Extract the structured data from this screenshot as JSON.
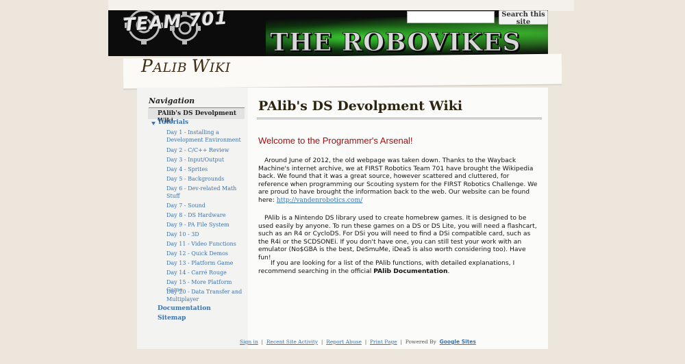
{
  "header": {
    "team_text": "TEAM 701",
    "title_text": "THE ROBOVIKES",
    "search_placeholder": "",
    "search_button": "Search this site"
  },
  "site_title": {
    "first": "P",
    "rest": "ALIB ",
    "w": "W",
    "iki": "IKI"
  },
  "nav": {
    "heading": "Navigation",
    "current": "PAlib's DS Devolpment Wiki",
    "tutorials": "Tutorials",
    "days": [
      "Day 1 - Installing a Development Environment",
      "Day 2 - C/C++ Review",
      "Day 3 - Input/Output",
      "Day 4 - Sprites",
      "Day 5 - Backgrounds",
      "Day 6 - Dev-related Math Stuff",
      "Day 7 - Sound",
      "Day 8 - DS Hardware",
      "Day 9 - PA File System",
      "Day 10 - 3D",
      "Day 11 - Video Functions",
      "Day 12 - Quick Demos",
      "Day 13 - Platform Game",
      "Day 14 - Carré Rouge",
      "Day 15 - More Platform Game",
      "Day 20 - Data Transfer and Multiplayer"
    ],
    "documentation": "Documentation",
    "sitemap": "Sitemap"
  },
  "main": {
    "title": "PAlib's DS Devolpment Wiki",
    "welcome": "Welcome to the Programmer's Arsenal!",
    "p1_text": "Around June of 2012, the old webpage was taken down.  Thanks to the Wayback Machine's internet archive, we at FIRST Robotics Team 701 have brought the Wikipedia back.  We found that it was a great source, however scattered and cluttered, for reference when programming our Scouting system for the FIRST Robotics Challenge.  We are proud to have brought the information back to the web.  Our website can be found here: ",
    "p1_link": "http://vandenrobotics.com/",
    "p2_text": "PAlib is a Nintendo DS library used to create homebrew games. It is designed to be used easily by anyone. To run these games on a DS or DS Lite, you will need a flashcart, such as an R4 or CycloDS. For DSi you will need to find a DSi compatible card, such as the R4i or the SCDSONEi. If you don't have one, you can still test your work with an emulator (No$GBA is the best, DeSmuMe, iDeaS is also worth considering too). Have fun!",
    "p3_text": "If you are looking for a list of the PAlib functions, with detailed explanations, I recommend searching in the official ",
    "p3_bold": "PAlib Documentation",
    "p3_end": "."
  },
  "footer": {
    "sign_in": "Sign in",
    "recent": "Recent Site Activity",
    "report": "Report Abuse",
    "print": "Print Page",
    "powered": "Powered By",
    "google_sites": "Google Sites"
  }
}
